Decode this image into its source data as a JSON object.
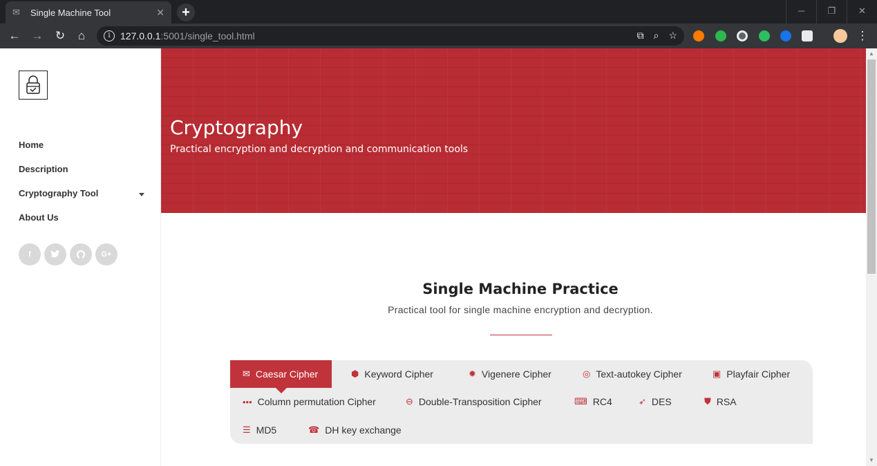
{
  "browser": {
    "tab_title": "Single Machine Tool",
    "url_host": "127.0.0.1",
    "url_path": ":5001/single_tool.html"
  },
  "sidebar": {
    "nav": [
      {
        "label": "Home"
      },
      {
        "label": "Description"
      },
      {
        "label": "Cryptography Tool"
      },
      {
        "label": "About Us"
      }
    ],
    "social": [
      "f",
      "t",
      "gh",
      "G+"
    ]
  },
  "hero": {
    "title": "Cryptography",
    "subtitle": "Practical encryption and decryption and communication tools",
    "color": "#b92c33"
  },
  "section": {
    "title": "Single Machine Practice",
    "subtitle": "Practical tool for single machine encryption and decryption."
  },
  "tools": [
    {
      "label": "Caesar Cipher",
      "icon": "envelope-icon",
      "active": true
    },
    {
      "label": "Keyword Cipher",
      "icon": "cubes-icon"
    },
    {
      "label": "Vigenere Cipher",
      "icon": "cog-icon"
    },
    {
      "label": "Text-autokey Cipher",
      "icon": "target-icon"
    },
    {
      "label": "Playfair Cipher",
      "icon": "pocket-icon"
    },
    {
      "label": "Column permutation Cipher",
      "icon": "dots-icon"
    },
    {
      "label": "Double-Transposition Cipher",
      "icon": "drive-icon"
    },
    {
      "label": "RC4",
      "icon": "keyboard-icon"
    },
    {
      "label": "DES",
      "icon": "paper-plane-icon"
    },
    {
      "label": "RSA",
      "icon": "shield-icon"
    },
    {
      "label": "MD5",
      "icon": "server-icon"
    },
    {
      "label": "DH key exchange",
      "icon": "phone-icon"
    }
  ],
  "accent_color": "#c0333a"
}
